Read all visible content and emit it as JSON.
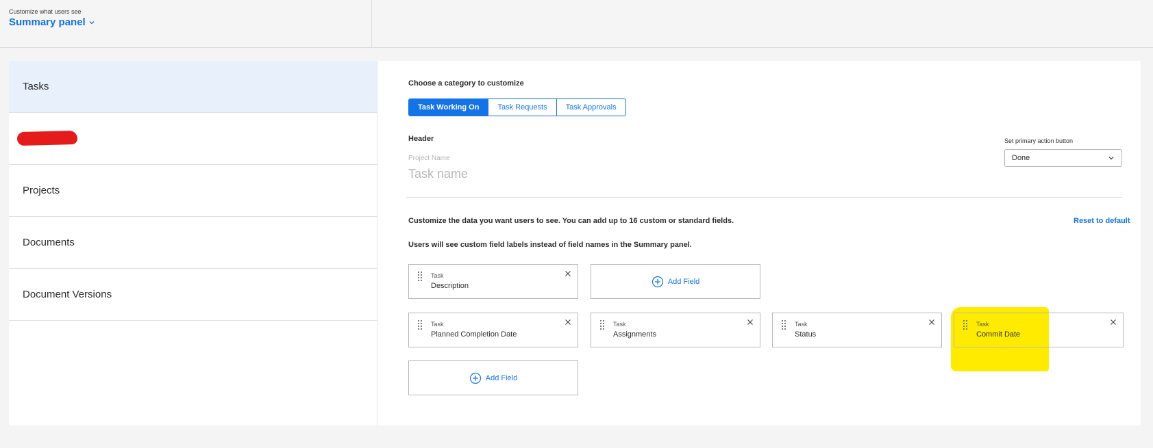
{
  "header": {
    "subtitle": "Customize what users see",
    "title": "Summary panel"
  },
  "sidebar": {
    "items": [
      {
        "label": "Tasks",
        "active": true
      },
      {
        "label": "",
        "redacted": true
      },
      {
        "label": "Projects"
      },
      {
        "label": "Documents"
      },
      {
        "label": "Document Versions"
      }
    ]
  },
  "main": {
    "category_label": "Choose a category to customize",
    "categories": [
      {
        "label": "Task Working On",
        "active": true
      },
      {
        "label": "Task Requests"
      },
      {
        "label": "Task Approvals"
      }
    ],
    "header_label": "Header",
    "project_name_placeholder": "Project Name",
    "task_name_placeholder": "Task name",
    "primary_action_label": "Set primary action button",
    "primary_action_value": "Done",
    "info_text_1": "Customize the data you want users to see. You can add up to 16 custom or standard fields.",
    "info_text_2": "Users will see custom field labels instead of field names in the Summary panel.",
    "reset_label": "Reset to default",
    "fields": [
      {
        "category": "Task",
        "name": "Description"
      },
      {
        "category": "Task",
        "name": "Planned Completion Date"
      },
      {
        "category": "Task",
        "name": "Assignments"
      },
      {
        "category": "Task",
        "name": "Status"
      },
      {
        "category": "Task",
        "name": "Commit Date",
        "highlighted": true
      }
    ],
    "add_field_label": "Add Field"
  },
  "colors": {
    "accent": "#1473e6",
    "active_bg": "#e8f0fb",
    "highlight": "#ffeb00",
    "redaction": "#e51b1b"
  }
}
